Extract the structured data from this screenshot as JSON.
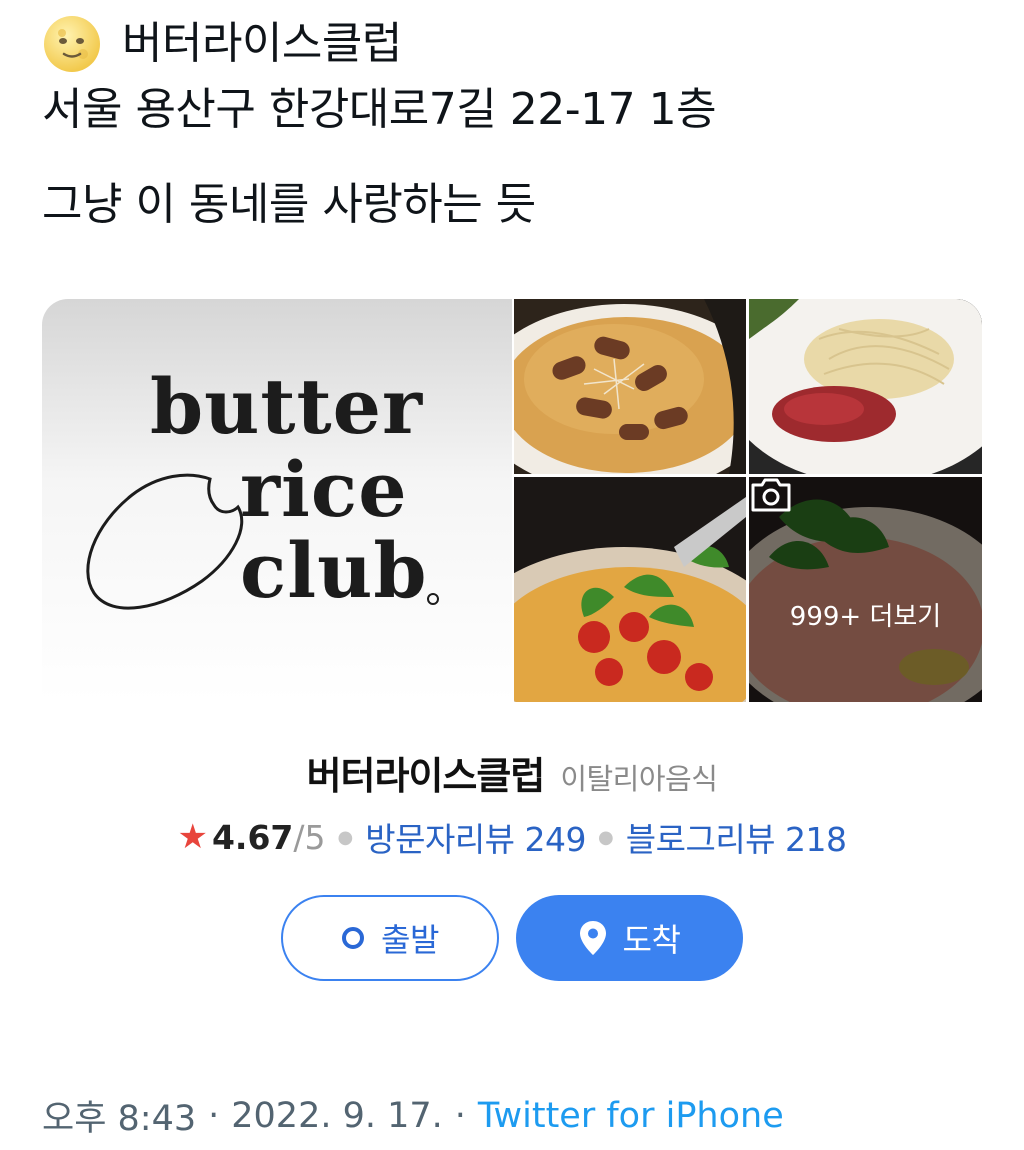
{
  "tweet": {
    "emoji_icon": "full-moon-face",
    "place_name_line": "버터라이스클럽",
    "address_line": "서울 용산구 한강대로7길 22-17 1층",
    "comment_line": "그냥 이 동네를 사랑하는 듯"
  },
  "card": {
    "logo": {
      "word1": "butter",
      "word2": "rice",
      "word3": "club"
    },
    "photos": [
      {
        "icon": "pasta-sausage-photo"
      },
      {
        "icon": "spaghetti-tartare-photo"
      },
      {
        "icon": "tomato-pasta-photo"
      },
      {
        "icon": "prosciutto-arugula-photo"
      }
    ],
    "more_photos_label": "999+ 더보기",
    "more_photos_icon": "camera-icon",
    "name": "버터라이스클럽",
    "category": "이탈리아음식",
    "rating": {
      "value": "4.67",
      "max": "/5",
      "icon": "star-icon",
      "color": "#e8453c"
    },
    "visitor_reviews": "방문자리뷰 249",
    "blog_reviews": "블로그리뷰 218",
    "depart_label": "출발",
    "arrive_label": "도착",
    "accent_color": "#3b82f0"
  },
  "meta": {
    "time": "오후 8:43",
    "separator": "·",
    "date": "2022. 9. 17.",
    "source": "Twitter for iPhone",
    "source_color": "#1d9bf0"
  }
}
